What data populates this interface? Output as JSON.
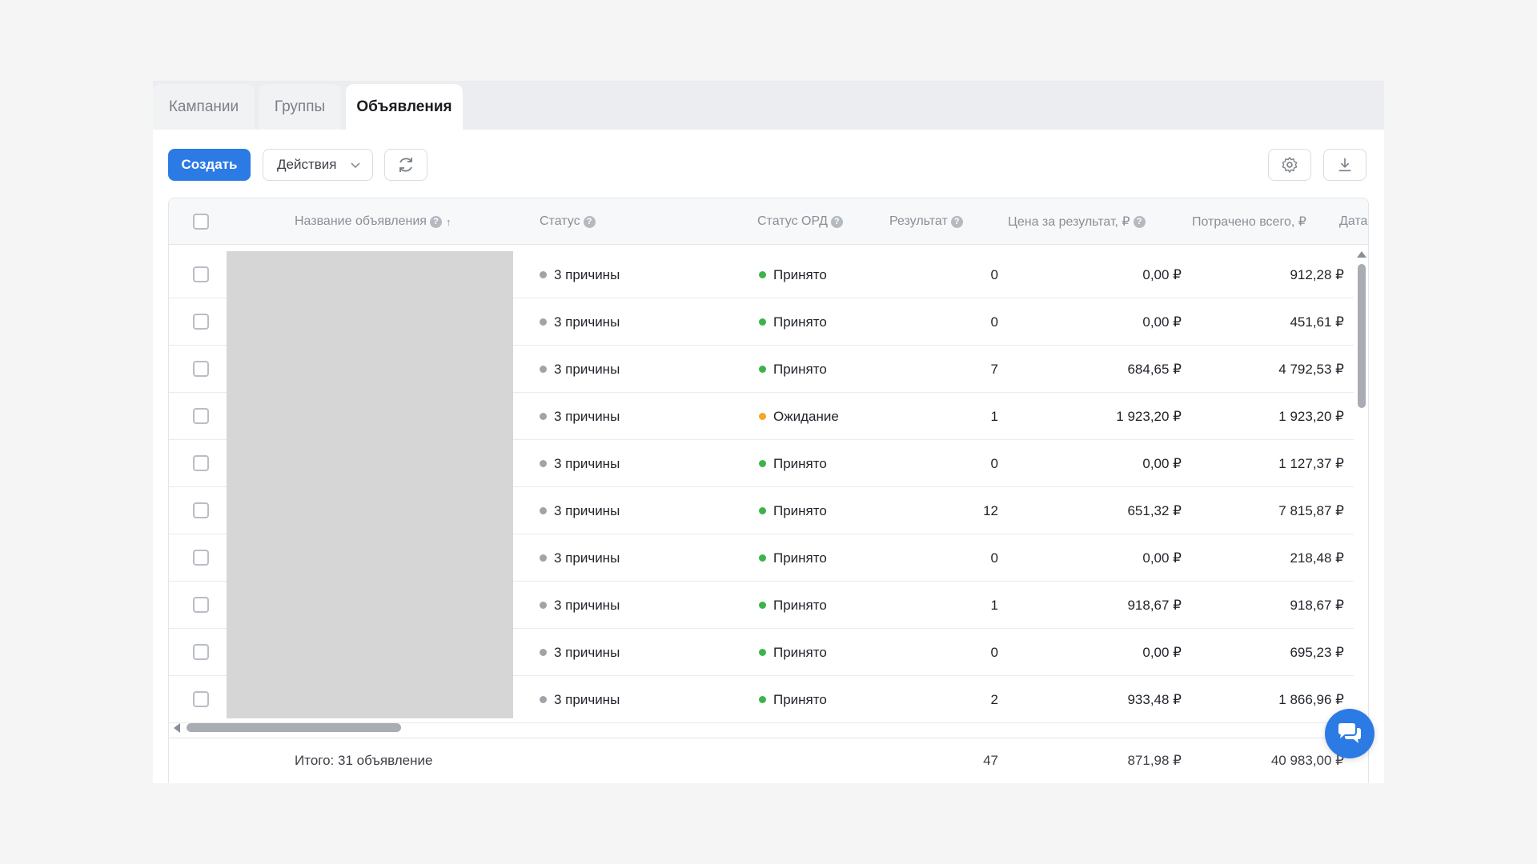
{
  "tabs": [
    {
      "label": "Кампании",
      "active": false
    },
    {
      "label": "Группы",
      "active": false
    },
    {
      "label": "Объявления",
      "active": true
    }
  ],
  "toolbar": {
    "create_label": "Создать",
    "actions_label": "Действия",
    "icons": {
      "refresh": "refresh-icon",
      "settings": "gear-icon",
      "download": "download-icon"
    }
  },
  "table": {
    "columns": {
      "name": "Название объявления",
      "status": "Статус",
      "ord_status": "Статус ОРД",
      "result": "Результат",
      "price": "Цена за результат, ₽",
      "spent": "Потрачено всего, ₽",
      "date": "Дата"
    },
    "rows": [
      {
        "status": "3 причины",
        "ord": "Принято",
        "ord_color": "#3cb44b",
        "result": "0",
        "price": "0,00 ₽",
        "spent": "912,28 ₽"
      },
      {
        "status": "3 причины",
        "ord": "Принято",
        "ord_color": "#3cb44b",
        "result": "0",
        "price": "0,00 ₽",
        "spent": "451,61 ₽"
      },
      {
        "status": "3 причины",
        "ord": "Принято",
        "ord_color": "#3cb44b",
        "result": "7",
        "price": "684,65 ₽",
        "spent": "4 792,53 ₽"
      },
      {
        "status": "3 причины",
        "ord": "Ожидание",
        "ord_color": "#f5a623",
        "result": "1",
        "price": "1 923,20 ₽",
        "spent": "1 923,20 ₽"
      },
      {
        "status": "3 причины",
        "ord": "Принято",
        "ord_color": "#3cb44b",
        "result": "0",
        "price": "0,00 ₽",
        "spent": "1 127,37 ₽"
      },
      {
        "status": "3 причины",
        "ord": "Принято",
        "ord_color": "#3cb44b",
        "result": "12",
        "price": "651,32 ₽",
        "spent": "7 815,87 ₽"
      },
      {
        "status": "3 причины",
        "ord": "Принято",
        "ord_color": "#3cb44b",
        "result": "0",
        "price": "0,00 ₽",
        "spent": "218,48 ₽"
      },
      {
        "status": "3 причины",
        "ord": "Принято",
        "ord_color": "#3cb44b",
        "result": "1",
        "price": "918,67 ₽",
        "spent": "918,67 ₽"
      },
      {
        "status": "3 причины",
        "ord": "Принято",
        "ord_color": "#3cb44b",
        "result": "0",
        "price": "0,00 ₽",
        "spent": "695,23 ₽"
      },
      {
        "status": "3 причины",
        "ord": "Принято",
        "ord_color": "#3cb44b",
        "result": "2",
        "price": "933,48 ₽",
        "spent": "1 866,96 ₽"
      }
    ],
    "footer": {
      "total_label": "Итого: 31 объявление",
      "result": "47",
      "price": "871,98 ₽",
      "spent": "40 983,00 ₽"
    }
  },
  "colors": {
    "accent": "#2c7be5",
    "status_gray": "#a0a4aa",
    "accepted": "#3cb44b",
    "pending": "#f5a623"
  },
  "chat": {
    "icon": "chat-icon"
  }
}
